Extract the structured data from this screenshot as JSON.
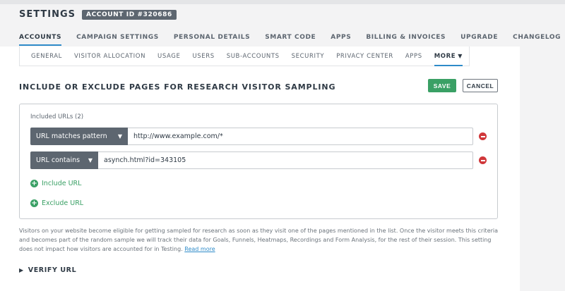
{
  "header": {
    "title": "SETTINGS",
    "account_badge": "ACCOUNT ID #320686"
  },
  "main_tabs": [
    {
      "label": "ACCOUNTS",
      "active": true
    },
    {
      "label": "CAMPAIGN SETTINGS"
    },
    {
      "label": "PERSONAL DETAILS"
    },
    {
      "label": "SMART CODE"
    },
    {
      "label": "APPS"
    },
    {
      "label": "BILLING & INVOICES"
    },
    {
      "label": "UPGRADE"
    },
    {
      "label": "CHANGELOG"
    }
  ],
  "sub_tabs": [
    {
      "label": "GENERAL"
    },
    {
      "label": "VISITOR ALLOCATION"
    },
    {
      "label": "USAGE"
    },
    {
      "label": "USERS"
    },
    {
      "label": "SUB-ACCOUNTS"
    },
    {
      "label": "SECURITY"
    },
    {
      "label": "PRIVACY CENTER"
    },
    {
      "label": "APPS"
    },
    {
      "label": "MORE",
      "active": true
    }
  ],
  "section": {
    "title": "INCLUDE OR EXCLUDE PAGES FOR RESEARCH VISITOR SAMPLING",
    "save_label": "SAVE",
    "cancel_label": "CANCEL"
  },
  "included": {
    "label": "Included URLs (2)",
    "rules": [
      {
        "type": "URL matches pattern",
        "value": "http://www.example.com/*"
      },
      {
        "type": "URL contains",
        "value": "asynch.html?id=343105"
      }
    ],
    "include_link": "Include URL",
    "exclude_link": "Exclude URL"
  },
  "description": {
    "text": "Visitors on your website become eligible for getting sampled for research as soon as they visit one of the pages mentioned in the list. Once the visitor meets this criteria and becomes part of the random sample we will track their data for Goals, Funnels, Heatmaps, Recordings and Form Analysis, for the rest of their session. This setting does not impact how visitors are accounted for in Testing.",
    "read_more": "Read more"
  },
  "verify": {
    "label": "VERIFY URL"
  },
  "colors": {
    "accent": "#2e8bc9",
    "save": "#3aa065",
    "remove": "#d0373a",
    "select_bg": "#5d6670"
  }
}
